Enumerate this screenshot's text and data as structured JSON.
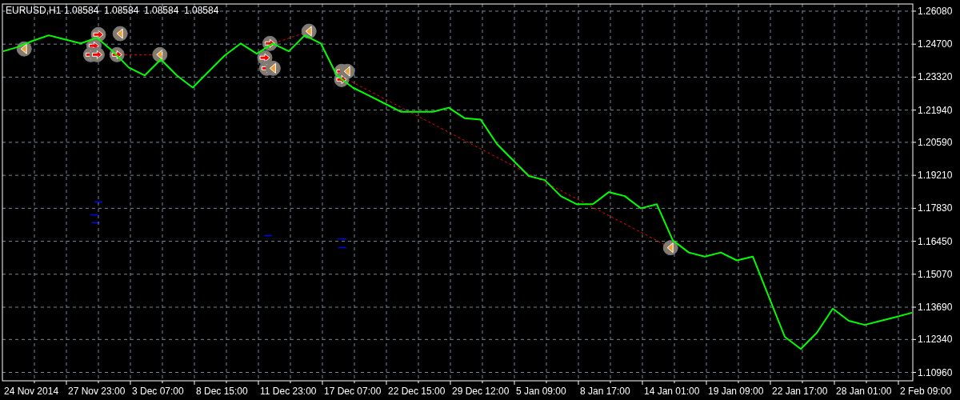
{
  "header": {
    "symbol": "EURUSD,H1",
    "quotes": [
      "1.08584",
      "1.08584",
      "1.08584",
      "1.08584"
    ]
  },
  "chart_data": {
    "type": "line",
    "grid": true,
    "categories": [
      null,
      null,
      "24 Nov 2014",
      null,
      null,
      null,
      "27 Nov 23:00",
      null,
      null,
      null,
      "3 Dec 07:00",
      null,
      null,
      null,
      "8 Dec 15:00",
      null,
      null,
      null,
      "11 Dec 23:00",
      null,
      null,
      null,
      "17 Dec 07:00",
      null,
      null,
      null,
      "22 Dec 15:00",
      null,
      null,
      null,
      "29 Dec 12:00",
      null,
      null,
      null,
      "5 Jan 09:00",
      null,
      null,
      null,
      "8 Jan 17:00",
      null,
      null,
      null,
      "14 Jan 01:00",
      null,
      null,
      null,
      "19 Jan 09:00",
      null,
      null,
      null,
      "22 Jan 17:00",
      null,
      null,
      null,
      "28 Jan 01:00",
      null,
      null,
      null,
      "2 Feb 09:00"
    ],
    "series": [
      {
        "color": "#00ff00",
        "values": [
          1.244,
          1.2457,
          1.2484,
          1.2507,
          1.249,
          1.2473,
          1.2497,
          1.244,
          1.2372,
          1.2339,
          1.2406,
          1.2339,
          1.2288,
          1.2356,
          1.2423,
          1.2473,
          1.243,
          1.2473,
          1.244,
          1.2507,
          1.2473,
          1.2339,
          1.2288,
          1.2255,
          1.2221,
          1.2187,
          1.2187,
          1.2187,
          1.2204,
          1.216,
          1.2154,
          1.2053,
          1.1985,
          1.1918,
          1.1901,
          1.1834,
          1.18,
          1.18,
          1.1851,
          1.1834,
          1.1783,
          1.18,
          1.1649,
          1.1598,
          1.1581,
          1.1598,
          1.1565,
          1.1581,
          1.1413,
          1.1245,
          1.1194,
          1.1262,
          1.1363,
          1.1312,
          1.1295,
          1.1312,
          1.1329,
          1.1346,
          null
        ]
      }
    ],
    "ylim": [
      1.1061,
      1.2638
    ],
    "yticks": [
      {
        "value": 1.2608,
        "label": "1.26080"
      },
      {
        "value": 1.247,
        "label": "1.24700"
      },
      {
        "value": 1.2332,
        "label": "1.23320"
      },
      {
        "value": 1.2194,
        "label": "1.21940"
      },
      {
        "value": 1.2059,
        "label": "1.20590"
      },
      {
        "value": 1.1921,
        "label": "1.19210"
      },
      {
        "value": 1.1783,
        "label": "1.17830"
      },
      {
        "value": 1.1645,
        "label": "1.16450"
      },
      {
        "value": 1.1507,
        "label": "1.15070"
      },
      {
        "value": 1.1369,
        "label": "1.13690"
      },
      {
        "value": 1.1234,
        "label": "1.12340"
      },
      {
        "value": 1.1096,
        "label": "1.10960"
      }
    ]
  }
}
